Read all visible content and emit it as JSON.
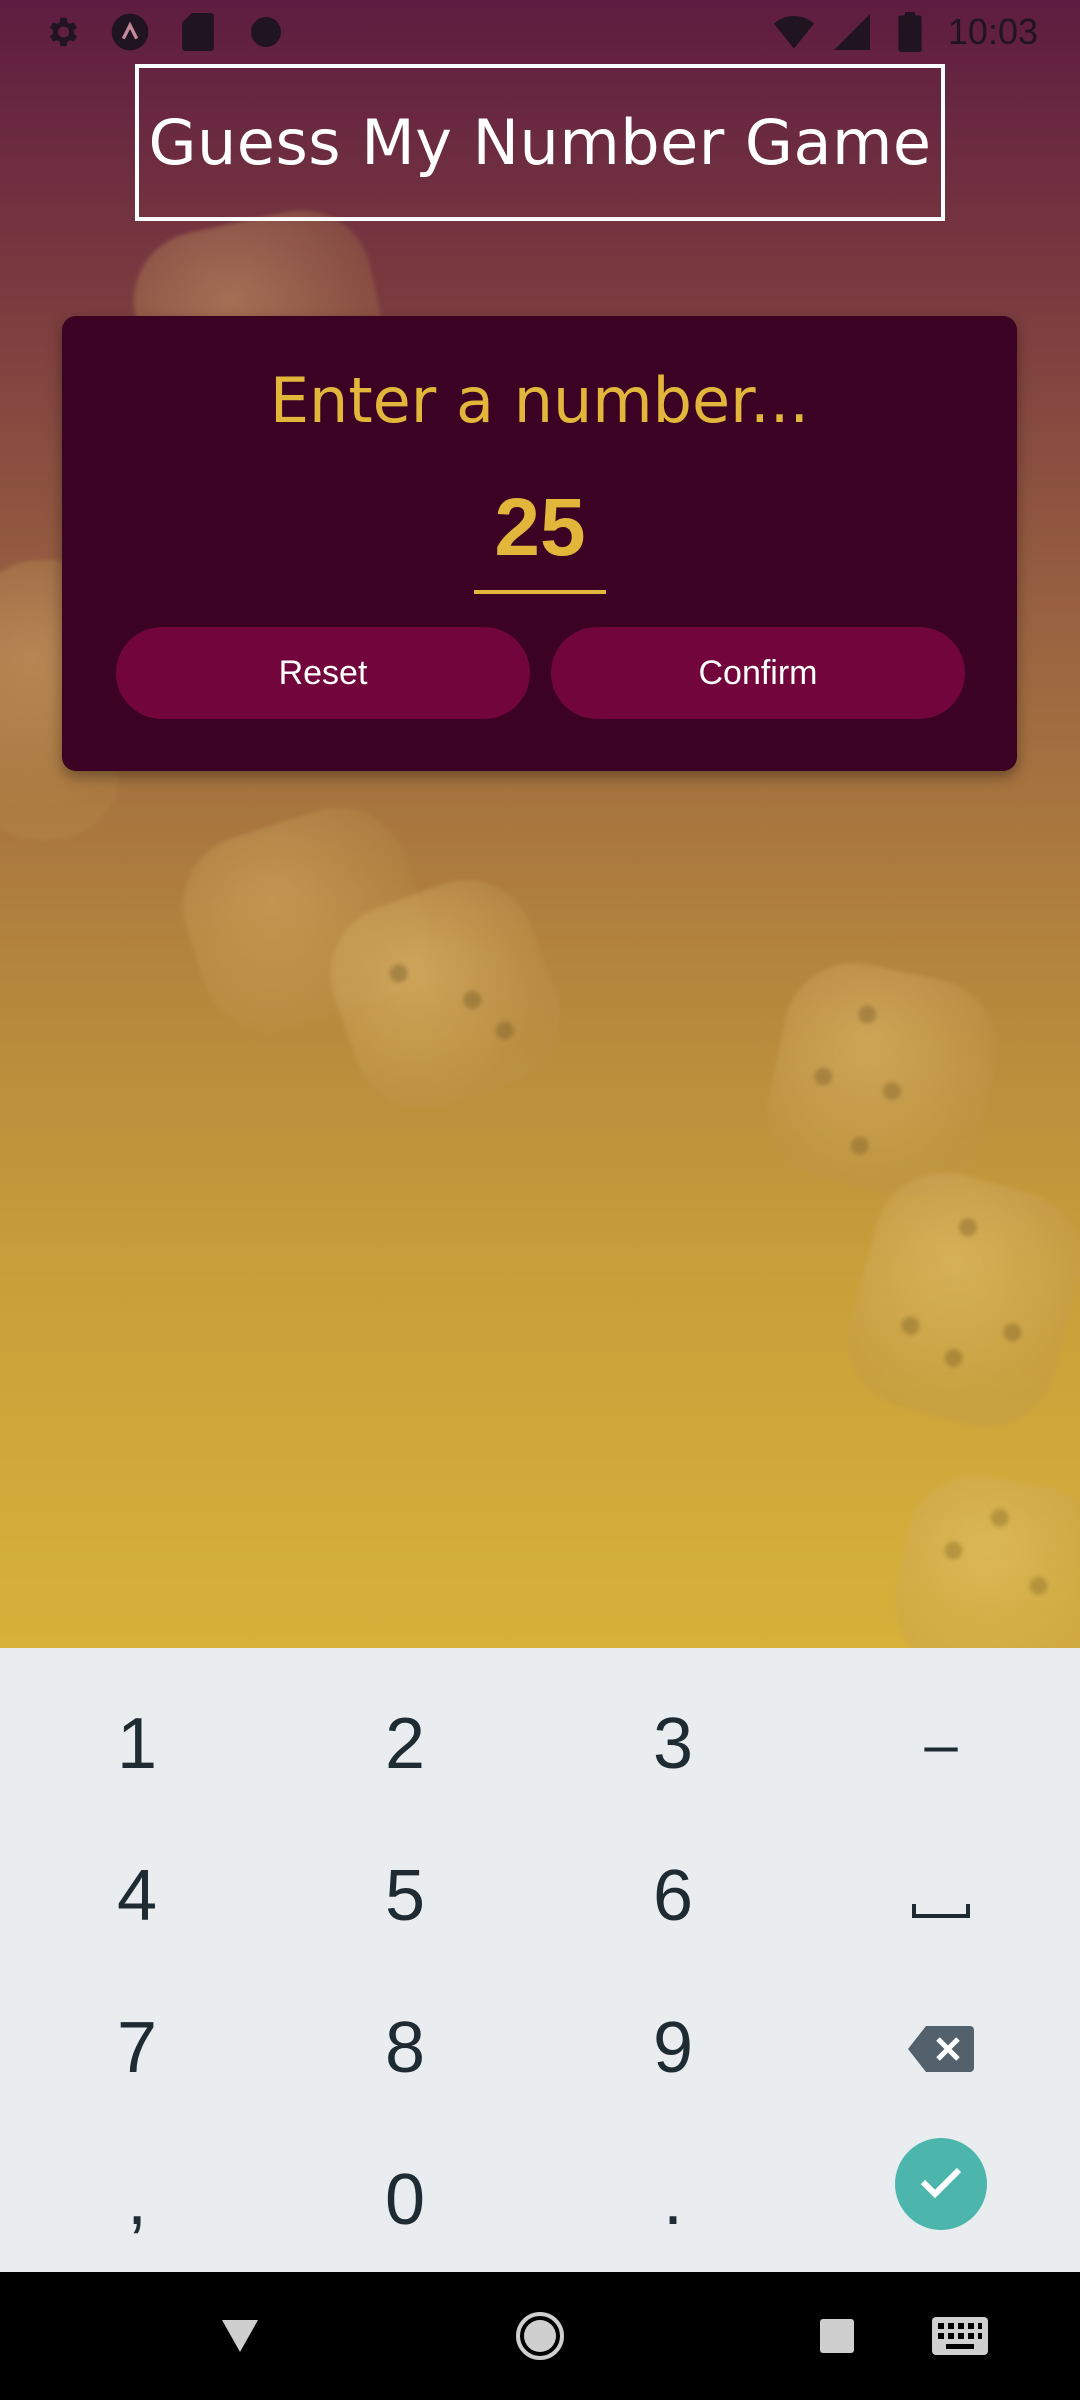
{
  "status_bar": {
    "time": "10:03",
    "left_icons": [
      "gear-icon",
      "expo-icon",
      "sd-card-icon",
      "circle-icon"
    ],
    "right_icons": [
      "wifi-icon",
      "signal-icon",
      "battery-icon"
    ]
  },
  "app": {
    "title": "Guess My Number Game",
    "card": {
      "prompt": "Enter a number...",
      "input_value": "25",
      "reset_label": "Reset",
      "confirm_label": "Confirm"
    },
    "colors": {
      "accent": "#e1b63a",
      "card_bg": "#3b0223",
      "button_bg": "#72063c",
      "title_border": "#ffffff"
    }
  },
  "keyboard": {
    "rows": [
      [
        "1",
        "2",
        "3",
        "–"
      ],
      [
        "4",
        "5",
        "6",
        "space"
      ],
      [
        "7",
        "8",
        "9",
        "backspace"
      ],
      [
        ",",
        "0",
        ".",
        "enter"
      ]
    ],
    "labels": {
      "k1": "1",
      "k2": "2",
      "k3": "3",
      "kminus": "–",
      "k4": "4",
      "k5": "5",
      "k6": "6",
      "k7": "7",
      "k8": "8",
      "k9": "9",
      "kcomma": ",",
      "k0": "0",
      "kdot": "."
    },
    "enter_color": "#4db6ac"
  },
  "nav_bar": {
    "buttons": [
      "back-icon",
      "home-icon",
      "recents-icon",
      "keyboard-icon"
    ]
  }
}
